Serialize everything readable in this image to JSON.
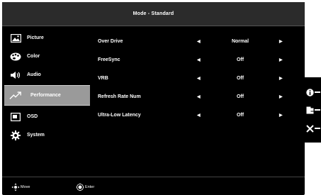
{
  "header": {
    "title": "Mode - Standard"
  },
  "sidebar": {
    "items": [
      {
        "label": "Picture",
        "icon": "picture-icon"
      },
      {
        "label": "Color",
        "icon": "palette-icon"
      },
      {
        "label": "Audio",
        "icon": "speaker-icon"
      },
      {
        "label": "Performance",
        "icon": "trend-arrow-icon",
        "selected": true
      },
      {
        "label": "OSD",
        "icon": "osd-window-icon"
      },
      {
        "label": "System",
        "icon": "gear-icon"
      }
    ]
  },
  "settings": {
    "rows": [
      {
        "label": "Over Drive",
        "value": "Normal"
      },
      {
        "label": "FreeSync",
        "value": "Off"
      },
      {
        "label": "VRB",
        "value": "Off"
      },
      {
        "label": "Refresh Rate Num",
        "value": "Off"
      },
      {
        "label": "Ultra-Low Latency",
        "value": "Off"
      }
    ]
  },
  "footer": {
    "move_label": "Move",
    "enter_label": "Enter"
  },
  "hotkeys": [
    "info-icon",
    "input-source-icon",
    "close-icon"
  ],
  "colors": {
    "background": "#000000",
    "title_bar": "#2b2b2b",
    "selected": "#9a9a9a",
    "text": "#ffffff"
  }
}
